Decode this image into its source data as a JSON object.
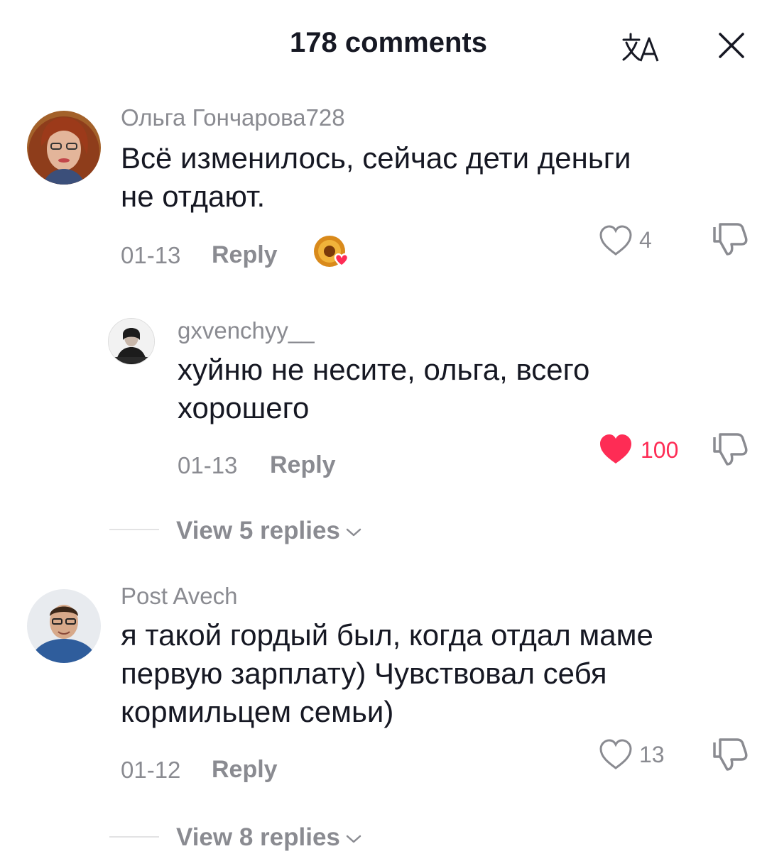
{
  "header": {
    "title": "178 comments",
    "translate_icon": "translate-icon",
    "close_icon": "close-icon"
  },
  "comments": [
    {
      "username": "Ольга Гончарова728",
      "text_line1": "Всё изменилось, сейчас дети деньги",
      "text_line2": "не отдают.",
      "date": "01-13",
      "reply_label": "Reply",
      "likes": "4",
      "liked": false,
      "creator_liked": true
    },
    {
      "username": "gxvenchyy__",
      "text_line1": "хуйню не несите, ольга, всего",
      "text_line2": "хорошего",
      "date": "01-13",
      "reply_label": "Reply",
      "likes": "100",
      "liked": true
    },
    {
      "username": "Post Avech",
      "text_line1": "я такой гордый был, когда отдал маме",
      "text_line2": "первую зарплату) Чувствовал себя",
      "text_line3": "кормильцем семьи)",
      "date": "01-12",
      "reply_label": "Reply",
      "likes": "13",
      "liked": false
    }
  ],
  "view_replies": [
    {
      "label": "View 5 replies"
    },
    {
      "label": "View 8 replies"
    }
  ],
  "colors": {
    "text": "#161823",
    "muted": "#8a8b91",
    "like_active": "#fe2c55",
    "divider": "#e3e3e4"
  }
}
